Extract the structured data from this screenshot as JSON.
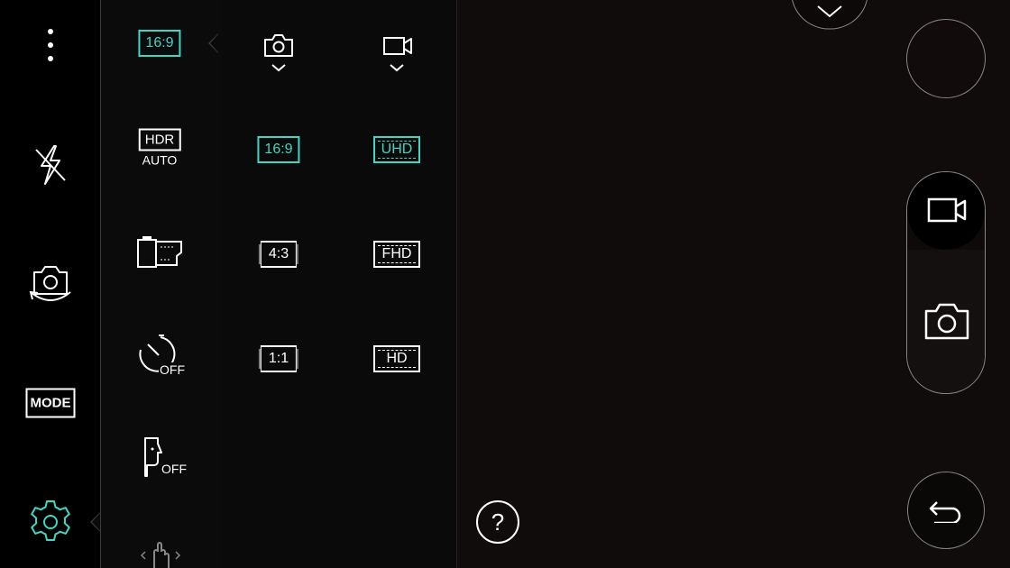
{
  "left_bar": {
    "mode_label": "MODE"
  },
  "settings_panel": {
    "ratio_label": "16:9",
    "hdr_label": "HDR",
    "hdr_value": "AUTO",
    "timer_value": "OFF",
    "voice_value": "OFF"
  },
  "photo_column": {
    "options": [
      "16:9",
      "4:3",
      "1:1"
    ]
  },
  "video_column": {
    "options": [
      "UHD",
      "FHD",
      "HD"
    ]
  },
  "help_label": "?",
  "colors": {
    "accent": "#3fd6c3",
    "icon": "#ffffff",
    "background": "#000000"
  },
  "icons": [
    "more-menu-icon",
    "flash-off-icon",
    "switch-camera-icon",
    "settings-gear-icon",
    "sd-card-icon",
    "timer-off-icon",
    "voice-shutter-icon",
    "gesture-hand-icon",
    "camera-icon",
    "video-icon",
    "chevron-down-icon",
    "back-arrow-icon"
  ]
}
